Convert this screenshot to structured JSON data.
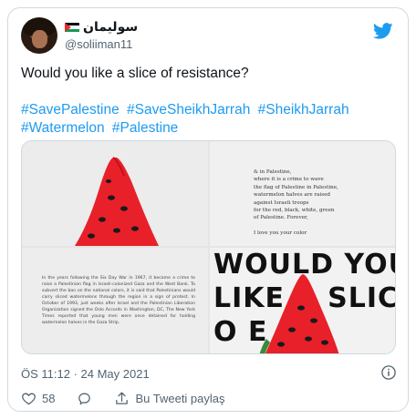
{
  "user": {
    "display_name": "سوليمان",
    "handle": "@soliiman11",
    "flag_icon": "palestine-flag-icon",
    "avatar": "user-avatar"
  },
  "tweet": {
    "text": "Would you like a slice of resistance?",
    "hashtags": [
      "#SavePalestine",
      "#SaveSheikhJarrah",
      "#SheikhJarrah",
      "#Watermelon",
      "#Palestine"
    ]
  },
  "media": {
    "poem_lines": [
      "& in Palestine,",
      "where it is a crime to wave",
      "the flag of Palestine in Palestine,",
      "watermelon halves are raised",
      "against Israeli troops",
      "for the red, black, white, green",
      "of Palestine. Forever,",
      "",
      "I love you your color"
    ],
    "paragraph": "In the years following the Six Day War in 1967, it became a crime to raise a Palestinian flag in Israeli-colonized Gaza and the West Bank. To subvert the ban on the national colors, it is said that Palestinians would carry sliced watermelons through the region in a sign of protest. In October of 1993, just weeks after Israel and the Palestinian Liberation Organization signed the Oslo Accords in Washington, DC, The New York Times reported that young men were once detained for holding watermelon halves in the Gaza Strip.",
    "big_lines": [
      "WOULD YOU",
      "LIKE A SLICE",
      "O          E"
    ]
  },
  "meta": {
    "timestamp": "ÖS 11:12 · 24 May 2021"
  },
  "actions": {
    "like_count": "58",
    "share_label": "Bu Tweeti paylaş"
  },
  "colors": {
    "accent": "#1d9bf0",
    "text_secondary": "#536471",
    "border": "#cfd9de",
    "melon_red": "#e8202a",
    "melon_green": "#3a8a3a"
  }
}
